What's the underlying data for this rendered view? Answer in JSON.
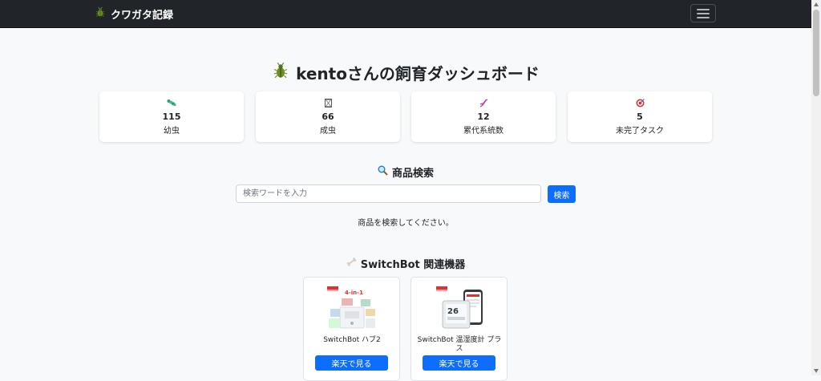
{
  "navbar": {
    "brand": "クワガタ記録",
    "brand_icon": "beetle-icon"
  },
  "page": {
    "title": "kentoさんの飼育ダッシュボード",
    "title_icon": "beetle-icon"
  },
  "stats": [
    {
      "icon": "larva-icon",
      "value": "115",
      "label": "幼虫"
    },
    {
      "icon": "hourglass-icon",
      "value": "66",
      "label": "成虫"
    },
    {
      "icon": "dna-icon",
      "value": "12",
      "label": "累代系統数"
    },
    {
      "icon": "target-icon",
      "value": "5",
      "label": "未完了タスク"
    }
  ],
  "search": {
    "title": "商品検索",
    "title_icon": "magnifier-icon",
    "placeholder": "検索ワードを入力",
    "value": "",
    "button": "検索",
    "message": "商品を検索してください。"
  },
  "switchbot": {
    "title": "SwitchBot 関連機器",
    "title_icon": "bone-icon",
    "products": [
      {
        "name": "SwitchBot ハブ2",
        "image_badge": "4-in-1",
        "button": "楽天で見る"
      },
      {
        "name": "SwitchBot 温湿度計 プラス",
        "image_badge": "26",
        "button": "楽天で見る"
      }
    ]
  },
  "colors": {
    "navbar_bg": "#212529",
    "page_bg": "#f8f9fa",
    "primary": "#0d6efd"
  }
}
